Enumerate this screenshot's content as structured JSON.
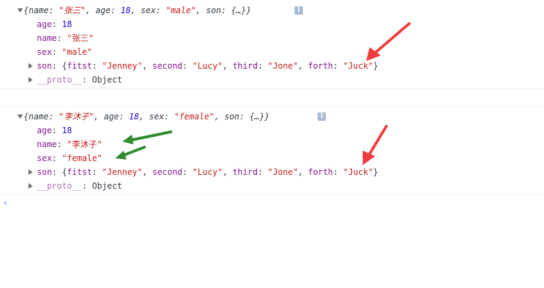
{
  "entries": [
    {
      "summary": {
        "open": "{",
        "name_key": "name",
        "name_val": "\"张三\"",
        "age_key": "age",
        "age_val": "18",
        "sex_key": "sex",
        "sex_val": "\"male\"",
        "son_key": "son",
        "son_val": "{…}",
        "close": "}",
        "info_icon": "i"
      },
      "props": {
        "age_key": "age",
        "age_val": "18",
        "name_key": "name",
        "name_val": "\"张三\"",
        "sex_key": "sex",
        "sex_val": "\"male\"",
        "son_key": "son",
        "son_fitst_key": "fitst",
        "son_fitst_val": "\"Jenney\"",
        "son_second_key": "second",
        "son_second_val": "\"Lucy\"",
        "son_third_key": "third",
        "son_third_val": "\"Jone\"",
        "son_forth_key": "forth",
        "son_forth_val": "\"Juck\"",
        "proto_key": "__proto__",
        "proto_val": "Object"
      }
    },
    {
      "summary": {
        "open": "{",
        "name_key": "name",
        "name_val": "\"李沐子\"",
        "age_key": "age",
        "age_val": "18",
        "sex_key": "sex",
        "sex_val": "\"female\"",
        "son_key": "son",
        "son_val": "{…}",
        "close": "}",
        "info_icon": "i"
      },
      "props": {
        "age_key": "age",
        "age_val": "18",
        "name_key": "name",
        "name_val": "\"李沐子\"",
        "sex_key": "sex",
        "sex_val": "\"female\"",
        "son_key": "son",
        "son_fitst_key": "fitst",
        "son_fitst_val": "\"Jenney\"",
        "son_second_key": "second",
        "son_second_val": "\"Lucy\"",
        "son_third_key": "third",
        "son_third_val": "\"Jone\"",
        "son_forth_key": "forth",
        "son_forth_val": "\"Juck\"",
        "proto_key": "__proto__",
        "proto_val": "Object"
      }
    }
  ],
  "prompt_icon": "chevron-right-icon",
  "colors": {
    "key": "#881391",
    "number": "#1c00cf",
    "string": "#c41a16",
    "proto": "#b06bb9",
    "arrow_red": "#f03c3c",
    "arrow_green": "#2e8b2e",
    "prompt": "#4b8bf5"
  }
}
